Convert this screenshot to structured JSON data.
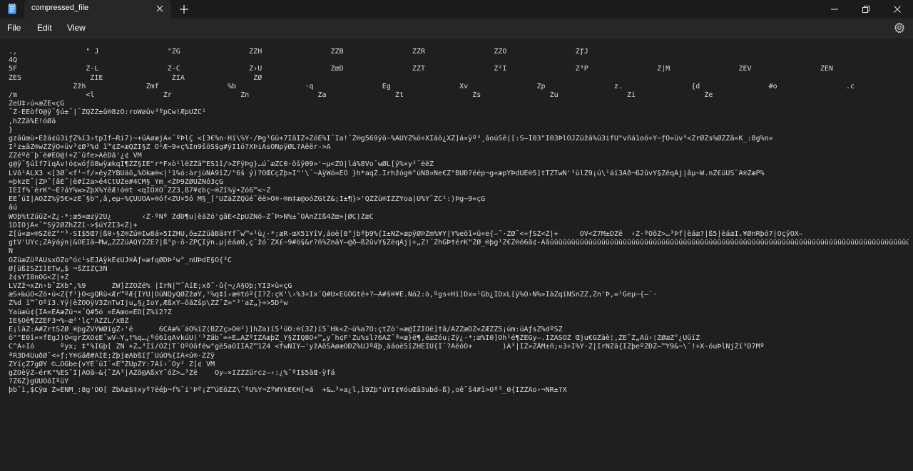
{
  "window": {
    "tab_title": "compressed_file",
    "new_tab_symbol": "+",
    "buttons": [
      "minimize",
      "maximize",
      "close"
    ]
  },
  "menu": {
    "file": "File",
    "edit": "Edit",
    "view": "View"
  },
  "icons": {
    "app": "notepad-icon",
    "settings": "gear-icon",
    "tab_close": "close-icon",
    "new_tab": "plus-icon"
  },
  "colors": {
    "titlebar": "#1b1b1b",
    "menubar": "#272727",
    "editor_bg": "#1f1f1f",
    "text": "#dcdcdc",
    "accent": "#4aa3ff"
  },
  "editor": {
    "lines": [
      ".,                \" J                \"ŽG                ŽŽH                ŽŽB                ŽŽR                ŽŽO                ŽƒJ",
      "4Q",
      "5F                Ž-L                Ž-C                Ž›U                ŽœD                ŽŽT                Ž²I                Ž³P                Ž|M                ŽÈV                ŽÉN",
      "ŽÉS                ŽÍE                ŽÏA                ŽØ",
      "               Žžh              Žmf                %b                ·q                Eg                Xv                Zp                z.                {d                #o                .c",
      "/m                <l                Žr                Žn                Ža                Žt                Žs                Žu                Ži                Že",
      "ŽeÜ‡›ú«æŽÉ«çG",
      "¯Ž-ËEòfÕ@ÿ¯§ú±¯|¯ŽQŽŽ±û®8zO:roWøüv³ºpCw!ÆpÜŽC¹",
      ",hŽŽã%Ë!óØä",
      "}",
      "gzâûœù•Ëžá¢û3iƒŽ%ï3›tpÏf–Ri7)~+üÄøæjÄ«¯ºÞlÇ <[3€%n·Hï\\%Ÿ·/Þg¹Gü+7ÎãÎŽ+ŽóÉ%Ï¯Ïa!¯Ž®g569ÿõ-%ÃÜŸŽ%ö÷XÏäö¿XŽ]á¤ÿº³¸ãoúSê|[:Š–Î03\"Ï03ÞlÕJŽüžâ%ü3ifÜ\"vñá1oó÷Y~ƒO«üv³<ŽrØŽs%ØŽŽã«K_:8g%n»",
      "Ï²z±ãŽ®wŽŽÿO«üv³¢Ø³%d ï™¢Ž=æQŽÏ§Ž Ô¹Æ~9«ç%Ín9šöŠ$g#ÿÏ1ó?XÞiÁsÕNpÿØL?Ãëër->Ã",
      "ŽŽéºë¯þ¯ë#ÊÖ@!+Z¯ûfe>ÃëDã'¿¢ VM",
      "g@ÿ¯§úîf7ïqÃv!ó¢wóƒõ8wÿækqÏ¶ŽŽ§ÏË\"r*Fxò¹lëŽŽã™ES1î/>ŽFÿÞg}…ú¯æŽC0·õšÿ09»'~µ<ŽO|lá%8Vo¯wØL[ÿ%×y²¯ëëŽ",
      "LVõ¹ÁLX3 <[3Ø¯<f¹~f/×êyŽYBÙäõ„%Ökæ®<|¹1%ó:àrjùÑÃ9îZ/\"6š ý)?ÕŒCçŽþ»Ï\"'\\¯~ÃÿWó=ÉÕ }h*aqŽ.Irhžóg®°úÑ8¤Ne€Ž\"BÜÐ?ëép¬g«æpŸÞdÛE®5]tTŽTwN'³ùlŽ9¡ú\\¹äï3Àð¬ß2ûvŸ§ŽëqÀj|åµ~W.nŽ€üÙŠ¯Ã®ŽæP%",
      "=þkzË¯|ŽÞ¯[åÈ¯|ë#ï2a>ë4CtÛŽe#4CM§_Ym_<ŽÞ9ŽØÙŽNó3çG",
      "ÏEÏf%¯érK\"~Ê?áŸ%w>ŽþX%ŸêÆ!ó®t <qÎÕXÔ¯ŽŽ3,ß7¥¢bç~®Žî%ÿ•Žó6™<~Ž",
      "ÈË¯úÍ|ÃÖŽŽ%ÿ5€»zË¯§b\",â,eµ~%ÇÜUÖÃ»®óf<ŽÜ×5ó M§_[‘UŽáŽŽQüé¯ëë>Ö®·®m‡æ@oóŽGtŽ&;Ì±¶}>'QŽŽù®ÏŽŽYoa|Ü%Ÿ¯ŽC¹:)Þg~9«çG",
      "åú",
      "WOþ%tŽúüŽ«Ž¿·*;æ5=æzÿ2Ú¿       ‹Ž·ºÑº ŽdÐ¶u|èáŽó'gåÉ<ŽpÜŽNó–Ž¯Þ>N%±¯ÕÂnŽÏß4Žœ»|ØC)ŽæC",
      "îDÏÖjÃ«¯“Šÿ2ØŽhŽŽî·>$úŸŽÏ3<Ž|+",
      "Ž[ú«æ«®ŠŽëZ°\"³·ŠÏ$5Œ?|ß0›§Z®Žú®Ïw8á»5ÍŽHÜ,õ±ZŽüåBä‡Ÿf¯w™÷¹ù¿·*;æR-œX51YîV,áoè[8°jbºþ9%{Ï±NŽ»æpÿØÞŽm%¥Ÿ|Ÿ%eöî«ü«e{–¯·ŽØ¯<÷ƒSŽ<Ž|+     OV<Ž7M±DŽë  ‹Ž·ºÕõŽ>…³Þf|èáæ?|ß5|èáæÎ.¥ØnRþó7|ÔçÿÖX–",
      "gtV'ÜŸc;ŽÃÿáýn|&ÖÊÏã–Mw„ŽŽŽüÃQŸŽŽE?|ß°p·ô-ŽPÇÏÿn.µ|ëáøÔ,ç¯žó¯ŽX£~9#ö§&r?ñ%ŽnäŸ–@ð–ß2ûvŸ§ŽëqÀj|÷„Ž!¯ŽhGÞ†érK\"ŽØ_®þg¹Z€Ž®ó6å¢-Ãåŭŭŭŭŭŭŭŭŭŭŭŭŭŭŭŭŭŭŭŭŭŭŭŭŭŭŭŭŭŭŭŭŭŭŭŭŭŭŭŭŭŭŭŭŭŭŭŭŭŭŭŭŭŭŭŭŭŭŭŭŭŭŭŭŭŭŭŭŭŭŭŭŭŭŭŭŭŭŭŭŭŭŭŭŭŭŭŭŭŭŭŭŭ",
      "Ñ",
      "ÖŽüæŽüºÄÜsxÕŽo^óc¹sEJÃÿkÉ¢ÜJ®Åƒ=æfqØDÞ²w°_nÜÞdE§Ö{³C",
      "Ø[üßÏŠŽÏîETw„$ ¬šŽÏŽÇ3N",
      "ž¢sŸÏ8nÖG<Ž|+Ž",
      "LVŽž¬xŽn›b¯ŽXb\",%9      ŽW]ŽŽÕŽë% |ÎrÑ|™¯ÁíÉ;xð¯·û{¬¿À§Õþ;YÏ3×ù«çG",
      "æŠ+‰úÖ<Žö•ú<Ž{f¹}O<gQRù<Ær™ºÆ{ÍYU|ÕüÑQyQØŽžøÝ,¹%q‡î›æ®tóº{Ï?Ž:çK'\\›%3÷Ïx¯Q#U×EGÕGtë+?–Ã#š®¥É.Nó2:ò,ºgs÷Hï]Dx=¹Gb¿ÍDxL[ÿ%Ö›N%»ÎàŽqïNŠnŽŽ,Žn'Þ,=¹Geµ~{–¯·",
      "Ž%d ï™¯Oºï3.Ÿÿ|èŽÕÕÿV3ŽnTwÏju„§¿ÏoY,ÆßxY–ôãŽšp\\ŽŽ¯Ž=\"³'aŽ„}÷>5D²w",
      "Ÿaüæù¢{ÏÃ=ÊÃæŽü¬×¯Q#5ó =ÊÃœo=ÊD[Ž%ï2?Ž",
      "ÏE§Õë¶ŽŽÊF3¬%–æ²'lç\"ÃŽŽL/xBŽ",
      "É¡lãŽ:Ä#ŽrtSŽØ_®þgŽVŸWØígŽ›'ë      6CÃæ%¯äÖ%ïŽ(BŽŽç>Ö®²)]hŽa)ï5¹úO:®ï3Ž)ï5¯Hk<Ž~ù%a7O:çtŽò'=æ@ÏŽÏÖë]†å/ÃŽŽæDŽ«ŽÆŽŽ5¡úm:úÃƒsŽ%dºSŽ",
      "ö\"\"Ê0î«¤fEgJ)Ò<grŽXÕ¢É¯wV–Ÿ„†%q…¿ºó6ïqÃvkúÚ('³Žãb¯=÷Ê…ÃŽºÏŽÀæþŽ_Ÿ§ŽÏQ8Ó÷™„y¯h¢F'Žu%sl?6ÃŽ¯ª=æ}ë¶,ëæŽóu¡Žÿ¿·*;æ%Ï0]Öh¹é¶ŽÉGy–.ÏŽÃSÕŽ Œju€GŽàè¦,ŽË¯Ž„Ãü›¦ŽØæŽ°¿ÙüïŽ",
      "C^Ã÷Îó      ºyx; ‡\"%ÏGþ[ ŽÑ +Ž…³Ïî/ÕŽ¦T¯OºÕõfëw\"gë5aÕÏÏÃŽ™1Ž4 <fwNÏŸ–'yžÃõŠÃøæÕÐŽ%ÚJºÆþ¸äáoë5îŽHÊÏÜ{Ï¯?ÃëóÖ+       )Ã³|ÏŽ»ŽÅM±ñ;¤3÷Ï%Ÿ·Ž|ÏrÑŽã{ÏŽþeºŽÐŽ–™Ÿ9&~\\¯!÷X-óuÞlNjŽï³D7Mº",
      "ªR3D4ÜuðØ¯<÷ƒ;Ÿ®GäÆ#AÏÊ;ŽþjæÄbßïƒ¯ÜúÕ%{ÏÃ<ú®·ŽŽÿ",
      "ŽYïçŽ7gØY ©…ÕGbe{vŸÉ¯üÏ¯«É™ŽÜpŽŸ:7Ãï›¯Oy² Ž[¢ VM",
      "gŽÓèÿŽ–érK\"%ÉŠ¯Î|ÃÖã–&{¯ŽÃ³|ÃŽõ@ÃßxY¯óŽ>…³Žë    Oy–×ÏŽŽŽürcz–‹:¿%¯ºÏ$5ãŒ-ÿfá",
      "?Ž6Ž}gÜUÕõÍºüŸ",
      "þb¯ì,$Cÿœ Ž=ÊÑM_:8g'ÕÕ[ ŽbÃæ$‡xyº?ëéþ¬f%¯í'Þº¡Ž™úÉöŽŽ\\¯ºÜ%Ÿ¬ŽºWŸkE€H[=á  +&…³»a¿l,î9Žþ\"úŸÏ¢¥óuŒâ3ubd–ß},oê¯š4#ï>Õº³_0{ÏŽŽÃo›¬ÑR±?X"
    ]
  }
}
